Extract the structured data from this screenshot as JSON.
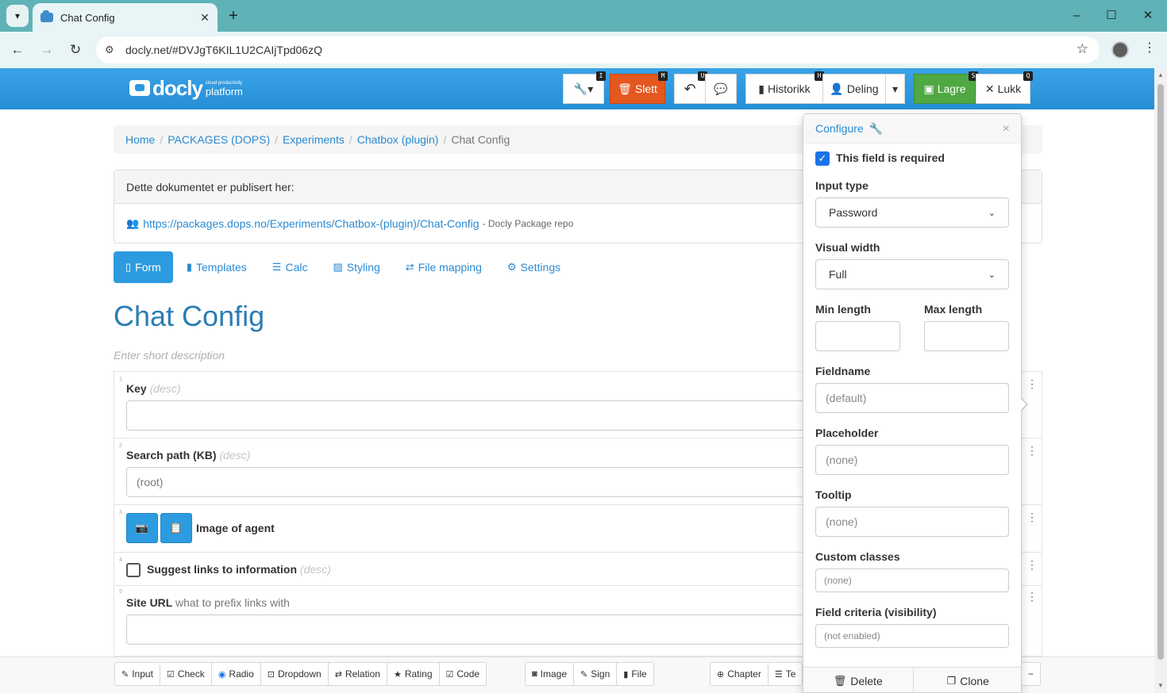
{
  "browser": {
    "tab_title": "Chat Config",
    "url": "docly.net/#DVJgT6KIL1U2CAIjTpd06zQ",
    "tab_menu_icon": "chevron-down",
    "new_tab": "+",
    "minimize": "–",
    "maximize": "☐",
    "close": "✕",
    "back": "←",
    "forward": "→",
    "reload": "↻",
    "site_info": "⚙",
    "star": "☆",
    "menu": "⋮"
  },
  "app": {
    "logo_word": "docly",
    "logo_tag": "cloud productivity",
    "logo_sub": "platform",
    "toolbar": {
      "tools_label": "🔧▾",
      "tools_kbd": "I",
      "delete_label": "Slett",
      "delete_kbd": "M",
      "undo_label": "↶",
      "undo_kbd": "U",
      "comment_label": "💬",
      "history_label": "Historikk",
      "history_kbd": "H",
      "share_label": "Deling",
      "share_dropdown": "▾",
      "save_label": "Lagre",
      "save_kbd": "S",
      "close_label": "Lukk",
      "close_kbd": "Q"
    }
  },
  "breadcrumb": {
    "items": [
      "Home",
      "PACKAGES (DOPS)",
      "Experiments",
      "Chatbox (plugin)"
    ],
    "active": "Chat Config",
    "separator": "/"
  },
  "publish": {
    "heading": "Dette dokumentet er publisert her:",
    "link": "https://packages.dops.no/Experiments/Chatbox-(plugin)/Chat-Config",
    "note": "- Docly Package repo"
  },
  "tabs": [
    {
      "icon": "📄",
      "label": "Form"
    },
    {
      "icon": "▮",
      "label": "Templates"
    },
    {
      "icon": "☰",
      "label": "Calc"
    },
    {
      "icon": "🖼",
      "label": "Styling"
    },
    {
      "icon": "⇄",
      "label": "File mapping"
    },
    {
      "icon": "⚙",
      "label": "Settings"
    }
  ],
  "document": {
    "title": "Chat Config",
    "description_placeholder": "Enter short description"
  },
  "fields": [
    {
      "num": "1",
      "label": "Key",
      "desc": "(desc)",
      "value": ""
    },
    {
      "num": "2",
      "label": "Search path (KB)",
      "desc": "(desc)",
      "value": "(root)"
    },
    {
      "num": "3",
      "label": "Image of agent"
    },
    {
      "num": "4",
      "label": "Suggest links to information",
      "desc": "(desc)"
    },
    {
      "num": "5",
      "label": "Site URL",
      "hint": "what to prefix links with",
      "value": ""
    }
  ],
  "field_menu": "⋮",
  "bottom_toolbar": {
    "group1": [
      {
        "icon": "✎",
        "label": "Input"
      },
      {
        "icon": "☑",
        "label": "Check"
      },
      {
        "icon": "◉",
        "label": "Radio"
      },
      {
        "icon": "⊡",
        "label": "Dropdown"
      },
      {
        "icon": "⇄",
        "label": "Relation"
      },
      {
        "icon": "★",
        "label": "Rating"
      },
      {
        "icon": "☑",
        "label": "Code"
      }
    ],
    "group2": [
      {
        "icon": "📷",
        "label": "Image"
      },
      {
        "icon": "✎",
        "label": "Sign"
      },
      {
        "icon": "▮",
        "label": "File"
      }
    ],
    "group3": [
      {
        "icon": "⊕",
        "label": "Chapter"
      },
      {
        "icon": "☰",
        "label": "Te"
      }
    ],
    "minus": "−"
  },
  "configure": {
    "title": "Configure",
    "close": "×",
    "required_label": "This field is required",
    "required_checked": true,
    "input_type_label": "Input type",
    "input_type_value": "Password",
    "visual_width_label": "Visual width",
    "visual_width_value": "Full",
    "min_length_label": "Min length",
    "max_length_label": "Max length",
    "min_length_value": "",
    "max_length_value": "",
    "fieldname_label": "Fieldname",
    "fieldname_placeholder": "(default)",
    "placeholder_label": "Placeholder",
    "placeholder_placeholder": "(none)",
    "tooltip_label": "Tooltip",
    "tooltip_placeholder": "(none)",
    "custom_classes_label": "Custom classes",
    "custom_classes_placeholder": "(none)",
    "criteria_label": "Field criteria (visibility)",
    "criteria_placeholder": "(not enabled)",
    "delete_label": "Delete",
    "clone_label": "Clone"
  },
  "colors": {
    "app_header": "#2d97dd",
    "delete_button": "#e4571f",
    "save_button": "#4fa842",
    "link": "#2a8ad3",
    "title": "#2a7db4",
    "browser_chrome": "#5fb2b6"
  }
}
